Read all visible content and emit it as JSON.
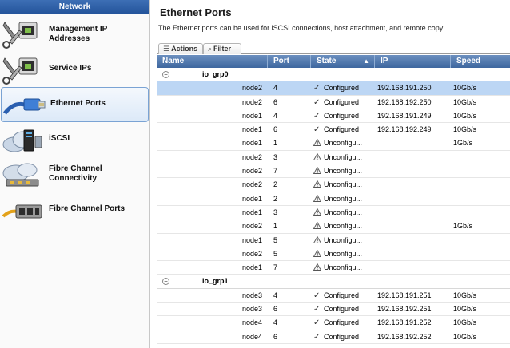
{
  "sidebar": {
    "header": "Network",
    "items": [
      {
        "label": "Management IP Addresses",
        "icon": "management-ip-icon"
      },
      {
        "label": "Service IPs",
        "icon": "service-ip-icon"
      },
      {
        "label": "Ethernet Ports",
        "icon": "ethernet-cable-icon",
        "selected": true
      },
      {
        "label": "iSCSI",
        "icon": "iscsi-cloud-icon"
      },
      {
        "label": "Fibre Channel Connectivity",
        "icon": "fibre-channel-cloud-icon"
      },
      {
        "label": "Fibre Channel Ports",
        "icon": "fibre-channel-ports-icon"
      }
    ]
  },
  "main": {
    "title": "Ethernet Ports",
    "description": "The Ethernet ports can be used for iSCSI connections, host attachment, and remote copy.",
    "toolbar": {
      "actions_label": "Actions",
      "filter_label": "Filter"
    },
    "columns": [
      "Name",
      "Port",
      "State",
      "IP",
      "Speed"
    ],
    "groups": [
      {
        "name": "io_grp0",
        "rows": [
          {
            "node": "node2",
            "port": "4",
            "state": "Configured",
            "ip": "192.168.191.250",
            "speed": "10Gb/s"
          },
          {
            "node": "node2",
            "port": "6",
            "state": "Configured",
            "ip": "192.168.192.250",
            "speed": "10Gb/s"
          },
          {
            "node": "node1",
            "port": "4",
            "state": "Configured",
            "ip": "192.168.191.249",
            "speed": "10Gb/s"
          },
          {
            "node": "node1",
            "port": "6",
            "state": "Configured",
            "ip": "192.168.192.249",
            "speed": "10Gb/s"
          },
          {
            "node": "node1",
            "port": "1",
            "state": "Unconfigu...",
            "ip": "",
            "speed": "1Gb/s"
          },
          {
            "node": "node2",
            "port": "3",
            "state": "Unconfigu...",
            "ip": "",
            "speed": ""
          },
          {
            "node": "node2",
            "port": "7",
            "state": "Unconfigu...",
            "ip": "",
            "speed": ""
          },
          {
            "node": "node2",
            "port": "2",
            "state": "Unconfigu...",
            "ip": "",
            "speed": ""
          },
          {
            "node": "node1",
            "port": "2",
            "state": "Unconfigu...",
            "ip": "",
            "speed": ""
          },
          {
            "node": "node1",
            "port": "3",
            "state": "Unconfigu...",
            "ip": "",
            "speed": ""
          },
          {
            "node": "node2",
            "port": "1",
            "state": "Unconfigu...",
            "ip": "",
            "speed": "1Gb/s"
          },
          {
            "node": "node1",
            "port": "5",
            "state": "Unconfigu...",
            "ip": "",
            "speed": ""
          },
          {
            "node": "node2",
            "port": "5",
            "state": "Unconfigu...",
            "ip": "",
            "speed": ""
          },
          {
            "node": "node1",
            "port": "7",
            "state": "Unconfigu...",
            "ip": "",
            "speed": ""
          }
        ]
      },
      {
        "name": "io_grp1",
        "rows": [
          {
            "node": "node3",
            "port": "4",
            "state": "Configured",
            "ip": "192.168.191.251",
            "speed": "10Gb/s"
          },
          {
            "node": "node3",
            "port": "6",
            "state": "Configured",
            "ip": "192.168.192.251",
            "speed": "10Gb/s"
          },
          {
            "node": "node4",
            "port": "4",
            "state": "Configured",
            "ip": "192.168.191.252",
            "speed": "10Gb/s"
          },
          {
            "node": "node4",
            "port": "6",
            "state": "Configured",
            "ip": "192.168.192.252",
            "speed": "10Gb/s"
          }
        ]
      }
    ]
  },
  "colors": {
    "header_blue": "#3e679f",
    "selection": "#bcd6f4",
    "sidebar_selected_border": "#7aa3d4"
  }
}
